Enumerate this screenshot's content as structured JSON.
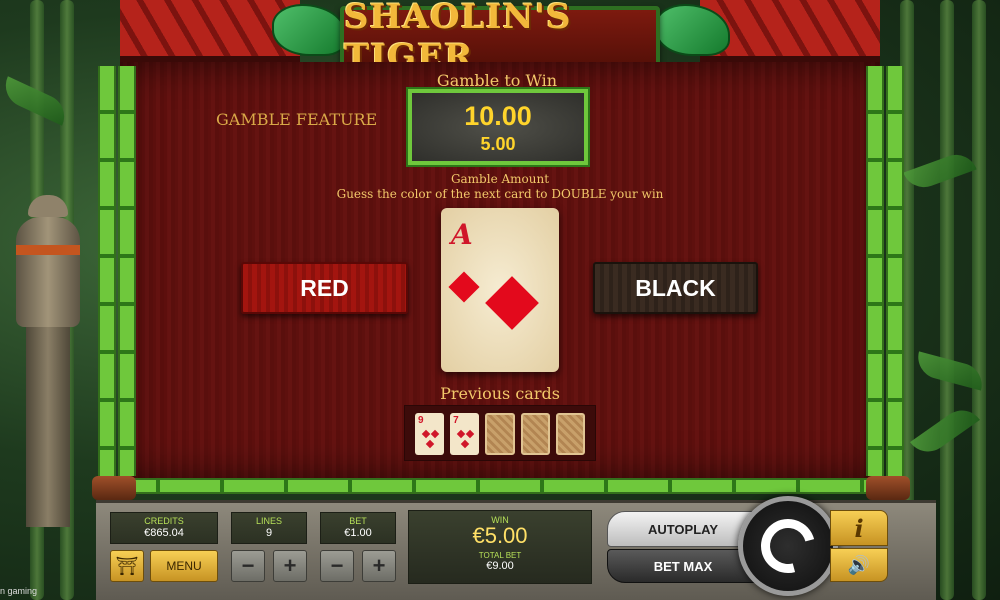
{
  "game": {
    "title": "SHAOLIN'S TIGER",
    "brand_text": "n gaming"
  },
  "gamble": {
    "to_win_label": "Gamble to Win",
    "to_win_value": "10.00",
    "amount_value": "5.00",
    "amount_label": "Gamble Amount",
    "feature_label": "GAMBLE FEATURE",
    "instruction": "Guess the color of the next card to DOUBLE your win",
    "red_button": "RED",
    "black_button": "BLACK"
  },
  "current_card": {
    "rank": "A",
    "suit": "diamonds",
    "suit_icon": "diamond-icon"
  },
  "previous": {
    "label": "Previous cards",
    "cards": [
      {
        "rank": "9",
        "suit": "hearts"
      },
      {
        "rank": "7",
        "suit": "hearts"
      },
      {
        "rank": "",
        "suit": "back"
      },
      {
        "rank": "",
        "suit": "back"
      },
      {
        "rank": "",
        "suit": "back"
      }
    ]
  },
  "bottom_bar": {
    "credits_label": "CREDITS",
    "credits_value": "€865.04",
    "lines_label": "LINES",
    "lines_value": "9",
    "bet_label": "BET",
    "bet_value": "€1.00",
    "menu_label": "MENU",
    "minus_symbol": "−",
    "plus_symbol": "+",
    "win_label": "WIN",
    "win_value": "€5.00",
    "total_bet_label": "TOTAL BET",
    "total_bet_value": "€9.00",
    "autoplay_label": "AUTOPLAY",
    "betmax_label": "BET MAX",
    "info_symbol": "i",
    "sound_symbol": "🔊"
  },
  "colors": {
    "accent_gold": "#ffd42b",
    "panel_red": "#5e100e",
    "bamboo_green": "#6fc83c"
  }
}
